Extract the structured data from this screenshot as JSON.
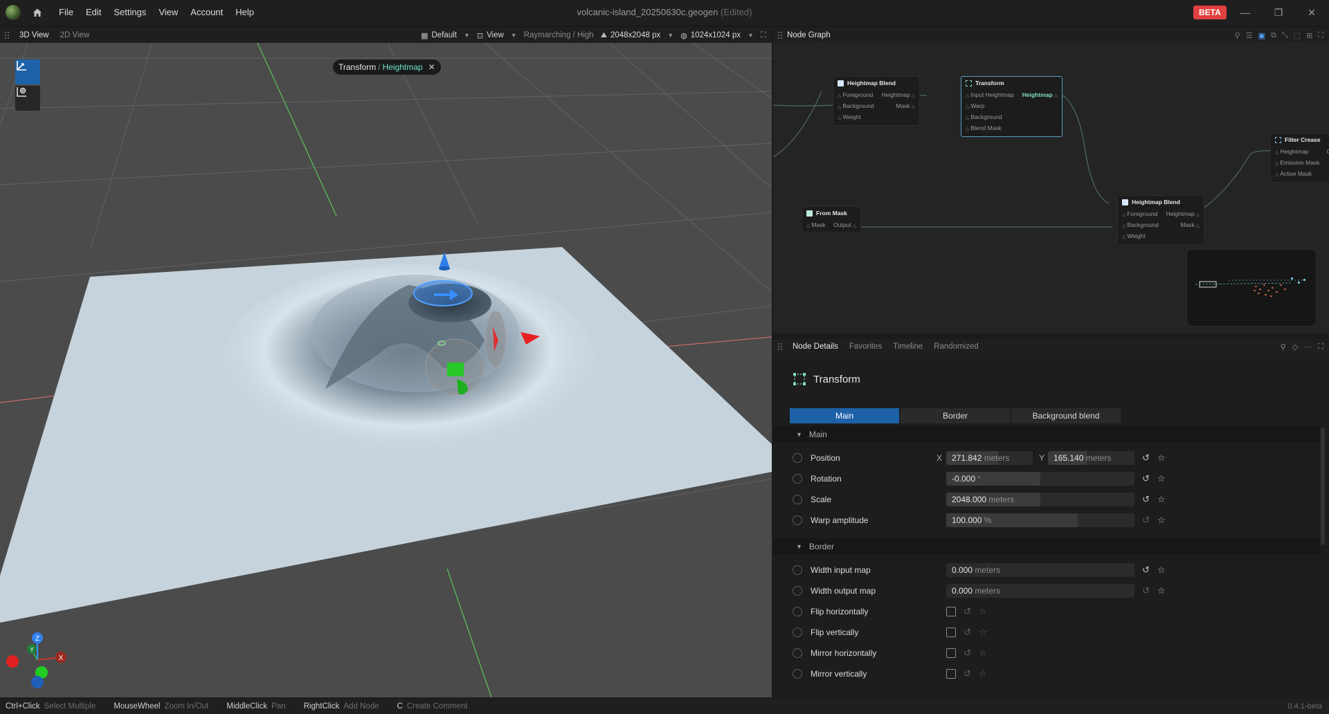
{
  "titlebar": {
    "menus": [
      "File",
      "Edit",
      "Settings",
      "View",
      "Account",
      "Help"
    ],
    "document": "volcanic-island_20250630c.geogen",
    "edited": "(Edited)",
    "beta": "BETA"
  },
  "view3d": {
    "tabs": [
      "3D View",
      "2D View"
    ],
    "preset": "Default",
    "view_menu": "View",
    "render_mode": "Raymarching / High",
    "resolution_a": "2048x2048 px",
    "resolution_b": "1024x1024 px",
    "breadcrumb": {
      "first": "Transform",
      "sep": "/",
      "second": "Heightmap"
    },
    "gizmo_axes": {
      "z": "Z",
      "y": "Y",
      "x": "X"
    }
  },
  "graph": {
    "title": "Node Graph",
    "nodes": {
      "blend1": {
        "title": "Heightmap Blend",
        "rows": [
          [
            "Foreground",
            "Heightmap"
          ],
          [
            "Background",
            "Mask"
          ],
          [
            "Weight",
            ""
          ]
        ]
      },
      "transform": {
        "title": "Transform",
        "rows": [
          [
            "Input Heightmap",
            "Heightmap"
          ],
          [
            "Warp",
            ""
          ],
          [
            "Background",
            ""
          ],
          [
            "Blend Mask",
            ""
          ]
        ]
      },
      "filter": {
        "title": "Filter Crease",
        "rows": [
          [
            "Heightmap",
            "Ou"
          ],
          [
            "Emission Mask",
            ""
          ],
          [
            "Active Mask",
            ""
          ]
        ]
      },
      "frommask": {
        "title": "From Mask",
        "rows": [
          [
            "Mask",
            "Output"
          ]
        ]
      },
      "blend2": {
        "title": "Heightmap Blend",
        "rows": [
          [
            "Foreground",
            "Heightmap"
          ],
          [
            "Background",
            "Mask"
          ],
          [
            "Weight",
            ""
          ]
        ]
      }
    }
  },
  "details": {
    "tabs": [
      "Node Details",
      "Favorites",
      "Timeline",
      "Randomized"
    ],
    "node_title": "Transform",
    "section_tabs": [
      "Main",
      "Border",
      "Background blend"
    ],
    "sections": {
      "main": "Main",
      "border": "Border"
    },
    "position": {
      "label": "Position",
      "x_axis": "X",
      "x_value": "271.842",
      "x_unit": "meters",
      "y_axis": "Y",
      "y_value": "165.140",
      "y_unit": "meters"
    },
    "rotation": {
      "label": "Rotation",
      "value": "-0.000",
      "unit": "°",
      "fill": 0.5
    },
    "scale": {
      "label": "Scale",
      "value": "2048.000",
      "unit": "meters",
      "fill": 0.5
    },
    "warp": {
      "label": "Warp amplitude",
      "value": "100.000",
      "unit": "%",
      "fill": 0.7
    },
    "width_in": {
      "label": "Width input map",
      "value": "0.000",
      "unit": "meters"
    },
    "width_out": {
      "label": "Width output map",
      "value": "0.000",
      "unit": "meters"
    },
    "flip_h": {
      "label": "Flip horizontally"
    },
    "flip_v": {
      "label": "Flip vertically"
    },
    "mirror_h": {
      "label": "Mirror horizontally"
    },
    "mirror_v": {
      "label": "Mirror vertically"
    }
  },
  "statusbar": {
    "hints": [
      {
        "key": "Ctrl+Click",
        "action": "Select Multiple"
      },
      {
        "key": "MouseWheel",
        "action": "Zoom In/Out"
      },
      {
        "key": "MiddleClick",
        "action": "Pan"
      },
      {
        "key": "RightClick",
        "action": "Add Node"
      },
      {
        "key": "C",
        "action": "Create Comment"
      }
    ],
    "version": "0.4.1-beta"
  },
  "colors": {
    "accent": "#1d62a8",
    "beta": "#e0403f",
    "highlight": "#6fe3c9"
  }
}
